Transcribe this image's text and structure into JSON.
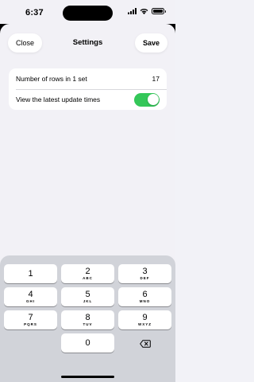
{
  "status_bar": {
    "time": "6:37",
    "icons": [
      "signal-icon",
      "wifi-icon",
      "battery-icon"
    ],
    "battery_level": 1.0
  },
  "nav": {
    "close_label": "Close",
    "title": "Settings",
    "save_label": "Save"
  },
  "settings": {
    "rows": [
      {
        "label": "Number of rows in 1 set",
        "value": "17"
      },
      {
        "label": "View the latest update times",
        "toggle_on": true
      }
    ]
  },
  "keyboard": {
    "keys": [
      {
        "digit": "1",
        "letters": ""
      },
      {
        "digit": "2",
        "letters": "ABC"
      },
      {
        "digit": "3",
        "letters": "DEF"
      },
      {
        "digit": "4",
        "letters": "GHI"
      },
      {
        "digit": "5",
        "letters": "JKL"
      },
      {
        "digit": "6",
        "letters": "MNO"
      },
      {
        "digit": "7",
        "letters": "PQRS"
      },
      {
        "digit": "8",
        "letters": "TUV"
      },
      {
        "digit": "9",
        "letters": "WXYZ"
      },
      {
        "digit": "0",
        "letters": ""
      }
    ],
    "delete_icon": "delete-icon"
  },
  "colors": {
    "toggle_on": "#34c759",
    "sheet_background": "#f2f1f6",
    "keyboard_background": "#d1d3d9"
  }
}
